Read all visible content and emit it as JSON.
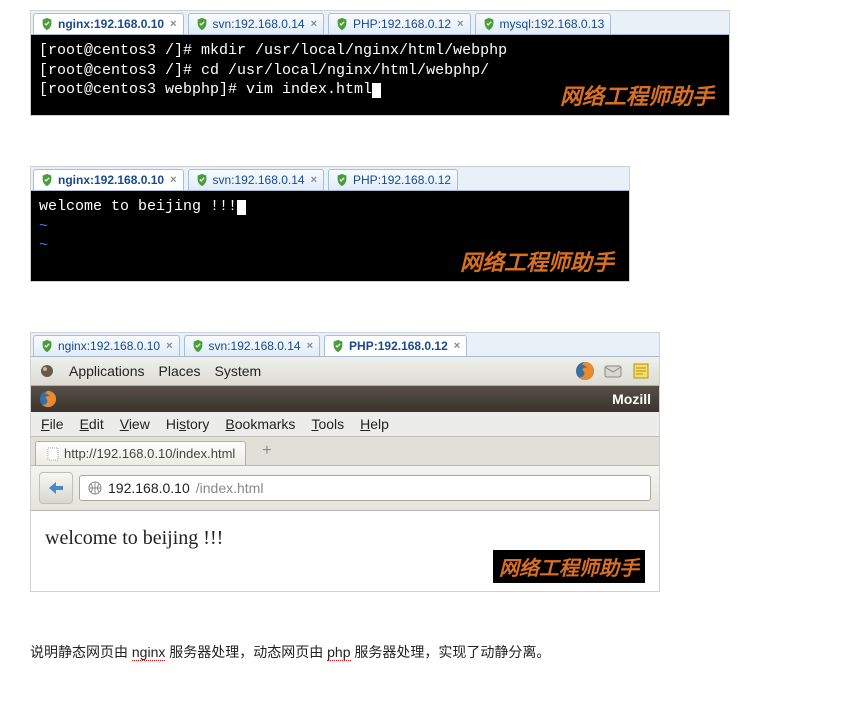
{
  "screenshot1": {
    "tabs": [
      {
        "label": "nginx:192.168.0.10",
        "active": true
      },
      {
        "label": "svn:192.168.0.14",
        "active": false
      },
      {
        "label": "PHP:192.168.0.12",
        "active": false
      },
      {
        "label": "mysql:192.168.0.13",
        "active": false
      }
    ],
    "lines": [
      "[root@centos3 /]# mkdir /usr/local/nginx/html/webphp",
      "[root@centos3 /]# cd /usr/local/nginx/html/webphp/",
      "[root@centos3 webphp]# vim index.html"
    ],
    "watermark": "网络工程师助手"
  },
  "screenshot2": {
    "tabs": [
      {
        "label": "nginx:192.168.0.10",
        "active": true
      },
      {
        "label": "svn:192.168.0.14",
        "active": false
      },
      {
        "label": "PHP:192.168.0.12",
        "active": false
      }
    ],
    "line1": "welcome to beijing !!!",
    "tilde": "~",
    "watermark": "网络工程师助手"
  },
  "screenshot3": {
    "tabs": [
      {
        "label": "nginx:192.168.0.10",
        "active": false
      },
      {
        "label": "svn:192.168.0.14",
        "active": false
      },
      {
        "label": "PHP:192.168.0.12",
        "active": true
      }
    ],
    "sys_menu": [
      "Applications",
      "Places",
      "System"
    ],
    "window_title_suffix": "Mozill",
    "ff_menu": [
      "File",
      "Edit",
      "View",
      "History",
      "Bookmarks",
      "Tools",
      "Help"
    ],
    "ff_tab_label": "http://192.168.0.10/index.html",
    "url_host": "192.168.0.10",
    "url_path": "/index.html",
    "page_text": "welcome to beijing !!!",
    "watermark": "网络工程师助手"
  },
  "caption": {
    "p1a": "说明静态网页由 ",
    "p1b": "nginx",
    "p1c": " 服务器处理，动态网页由 ",
    "p1d": "php",
    "p1e": " 服务器处理，实现了动静分离。"
  }
}
